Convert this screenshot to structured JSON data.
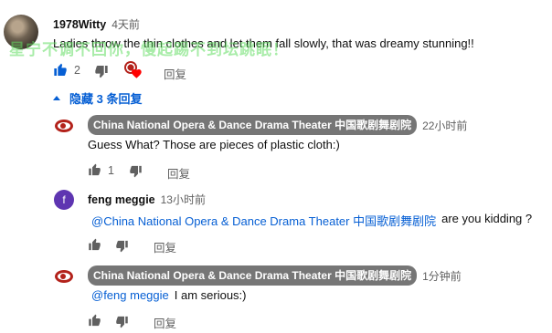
{
  "comment": {
    "author": "1978Witty",
    "time": "4天前",
    "text": "Ladies throw the thin clothes and let them fall slowly, that was dreamy stunning!!",
    "likes": "2",
    "reply_label": "回复"
  },
  "watermark": "星宁不调不回你，慢起踢不到坛跳眠！",
  "replies_toggle": "隐藏 3 条回复",
  "replies": [
    {
      "author": "China National Opera & Dance Drama Theater 中国歌剧舞剧院",
      "time": "22小时前",
      "text": "Guess What?  Those are pieces of plastic cloth:)",
      "likes": "1",
      "reply_label": "回复"
    },
    {
      "author": "feng meggie",
      "avatar_letter": "f",
      "time": "13小时前",
      "mention": "@China National Opera & Dance Drama Theater 中国歌剧舞剧院",
      "text": "are you kidding ?",
      "reply_label": "回复"
    },
    {
      "author": "China National Opera & Dance Drama Theater 中国歌剧舞剧院",
      "time": "1分钟前",
      "mention": "@feng meggie",
      "text": "I am serious:)",
      "reply_label": "回复"
    }
  ],
  "icons": {
    "like_main": "thumbs-up-filled-icon",
    "dislike": "thumbs-down-icon",
    "heart": "creator-heart-icon",
    "like": "thumbs-up-icon"
  },
  "colors": {
    "link": "#065fd4",
    "heart": "#ff0000",
    "secondary_text": "#606060",
    "chip_bg": "#767676"
  }
}
